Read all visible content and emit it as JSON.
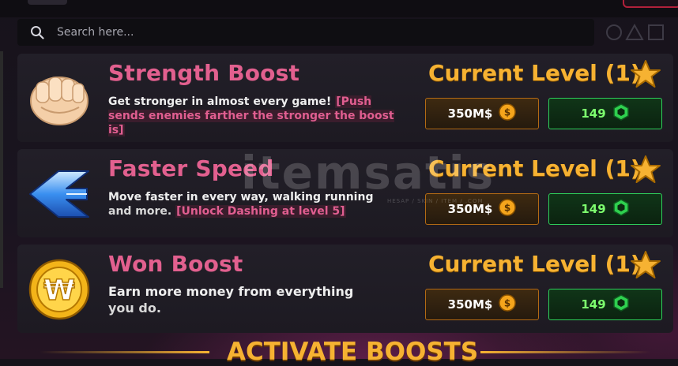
{
  "search": {
    "placeholder": "Search here..."
  },
  "boosts": [
    {
      "title": "Strength Boost",
      "desc": "Get stronger in almost every game!",
      "tag": "[Push sends enemies farther the stronger the boost is]",
      "tag_prefix": " ",
      "level": "Current Level (1)",
      "cash": "350M$",
      "gems": "149",
      "icon": "fist-icon"
    },
    {
      "title": "Faster Speed",
      "desc": "Move faster in every way, walking running",
      "desc2": "and more.",
      "tag": "[Unlock Dashing at level 5]",
      "level": "Current Level (1)",
      "cash": "350M$",
      "gems": "149",
      "icon": "speed-arrow-icon"
    },
    {
      "title": "Won Boost",
      "desc": "Earn more money from everything",
      "desc2": "you do.",
      "level": "Current Level (1)",
      "cash": "350M$",
      "gems": "149",
      "icon": "won-coin-icon"
    }
  ],
  "watermark": {
    "text": "itemsatis",
    "sub": "HESAP / SKIN / ITEM / .COM"
  },
  "footer": {
    "activate_label": "ACTIVATE BOOSTS"
  },
  "colors": {
    "title_pink": "#e2608f",
    "gold": "#f6b232",
    "gem_green": "#7dff6e"
  }
}
